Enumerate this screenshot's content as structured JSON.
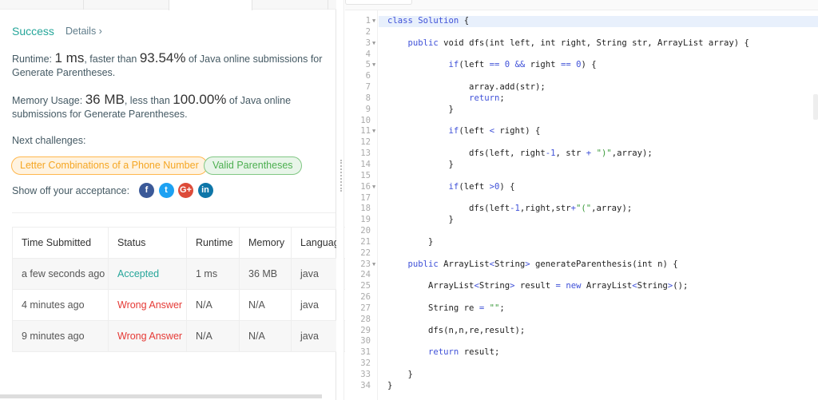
{
  "result": {
    "status": "Success",
    "details_label": "Details ›",
    "runtime_label": "Runtime: ",
    "runtime_value": "1 ms",
    "runtime_mid": ", faster than ",
    "runtime_pct": "93.54%",
    "runtime_tail": " of Java online submissions for Generate Parentheses.",
    "memory_label": "Memory Usage: ",
    "memory_value": "36 MB",
    "memory_mid": ", less than ",
    "memory_pct": "100.00%",
    "memory_tail": " of Java online submissions for Generate Parentheses.",
    "next_label": "Next challenges:",
    "challenges": [
      "Letter Combinations of a Phone Number",
      "Valid Parentheses"
    ],
    "share_label": "Show off your acceptance:",
    "social": [
      {
        "icon": "facebook-icon",
        "glyph": "f",
        "color": "#3b5998"
      },
      {
        "icon": "twitter-icon",
        "glyph": "t",
        "color": "#1da1f2"
      },
      {
        "icon": "google-plus-icon",
        "glyph": "G+",
        "color": "#dd4b39"
      },
      {
        "icon": "linkedin-icon",
        "glyph": "in",
        "color": "#0e76a8"
      }
    ]
  },
  "table": {
    "headers": [
      "Time Submitted",
      "Status",
      "Runtime",
      "Memory",
      "Languag"
    ],
    "rows": [
      [
        "a few seconds ago",
        "Accepted",
        "1 ms",
        "36 MB",
        "java"
      ],
      [
        "4 minutes ago",
        "Wrong Answer",
        "N/A",
        "N/A",
        "java"
      ],
      [
        "9 minutes ago",
        "Wrong Answer",
        "N/A",
        "N/A",
        "java"
      ]
    ]
  },
  "colors": {
    "accepted": "#26a69a",
    "wrong": "#e53935",
    "keyword": "#3f51d8",
    "string": "#3a9a3a"
  },
  "editor": {
    "fold_lines": [
      1,
      3,
      5,
      11,
      16,
      23
    ],
    "lines": [
      "class Solution {",
      "",
      "    public void dfs(int left, int right, String str, ArrayList array) {",
      "",
      "            if(left == 0 && right == 0) {",
      "",
      "                array.add(str);",
      "                return;",
      "            }",
      "",
      "            if(left < right) {",
      "",
      "                dfs(left, right-1, str + \")\",array);",
      "            }",
      "",
      "            if(left >0) {",
      "",
      "                dfs(left-1,right,str+\"(\",array);",
      "            }",
      "",
      "        }",
      "",
      "    public ArrayList<String> generateParenthesis(int n) {",
      "",
      "        ArrayList<String> result = new ArrayList<String>();",
      "",
      "        String re = \"\";",
      "",
      "        dfs(n,n,re,result);",
      "",
      "        return result;",
      "",
      "    }",
      "}"
    ]
  }
}
